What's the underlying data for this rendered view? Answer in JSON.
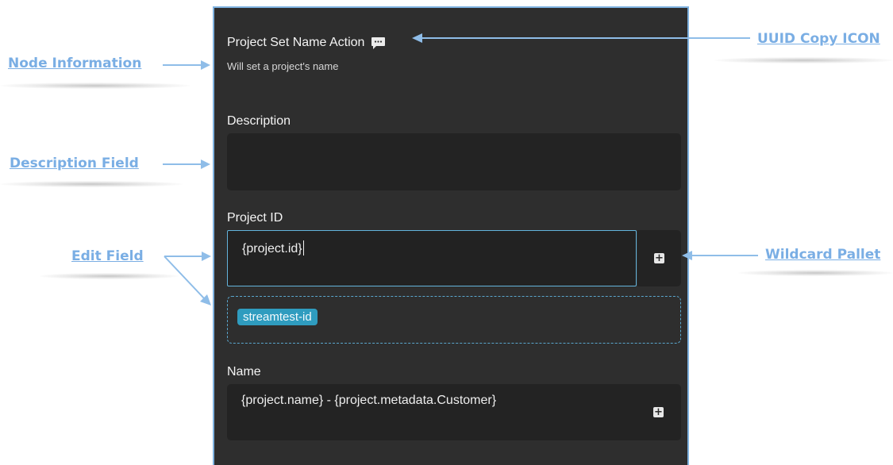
{
  "node": {
    "title": "Project Set Name Action",
    "subtitle": "Will set a project's name"
  },
  "fields": {
    "description_label": "Description",
    "description_value": "",
    "project_id_label": "Project ID",
    "project_id_value": "{project.id}",
    "wildcard_chip": "streamtest-id",
    "name_label": "Name",
    "name_value": "{project.name} - {project.metadata.Customer}"
  },
  "annotations": {
    "node_information": "Node Information",
    "description_field": "Description Field",
    "edit_field": "Edit Field",
    "uuid_copy_icon": "UUID Copy ICON",
    "wildcard_pallet": "Wildcard Pallet"
  },
  "icons": {
    "uuid_copy": "comment-bubble-icon",
    "wildcard_add": "plus-square-icon"
  },
  "colors": {
    "panel_bg": "#2e2e2e",
    "panel_border": "#7fb2e0",
    "accent": "#2f9cbf",
    "annotation": "#7aaee4"
  }
}
